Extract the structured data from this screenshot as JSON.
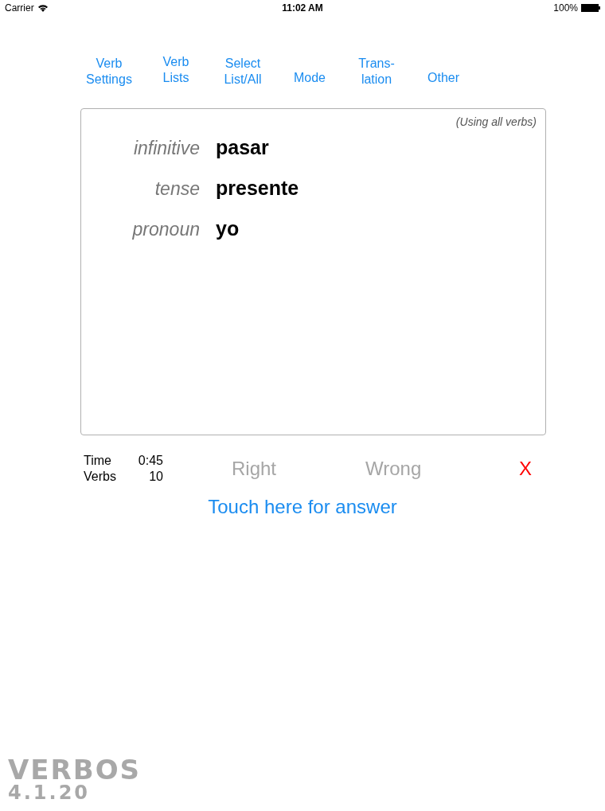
{
  "status_bar": {
    "carrier": "Carrier",
    "time": "11:02 AM",
    "battery": "100%"
  },
  "menu": [
    {
      "label": "Verb\nSettings"
    },
    {
      "label": "Verb\nLists"
    },
    {
      "label": "Select\nList/All"
    },
    {
      "label": "Mode"
    },
    {
      "label": "Trans-\nlation"
    },
    {
      "label": "Other"
    }
  ],
  "card": {
    "note": "(Using all verbs)",
    "fields": [
      {
        "label": "infinitive",
        "value": "pasar"
      },
      {
        "label": "tense",
        "value": "presente"
      },
      {
        "label": "pronoun",
        "value": "yo"
      }
    ]
  },
  "stats": [
    {
      "label": "Time",
      "value": "0:45"
    },
    {
      "label": "Verbs",
      "value": "10"
    }
  ],
  "actions": [
    {
      "label": "Right",
      "disabled": true
    },
    {
      "label": "Wrong",
      "disabled": true
    }
  ],
  "close": {
    "label": "X"
  },
  "answer_button": "Touch here for answer",
  "branding": {
    "name": "VERBOS",
    "version": "4.1.20"
  }
}
